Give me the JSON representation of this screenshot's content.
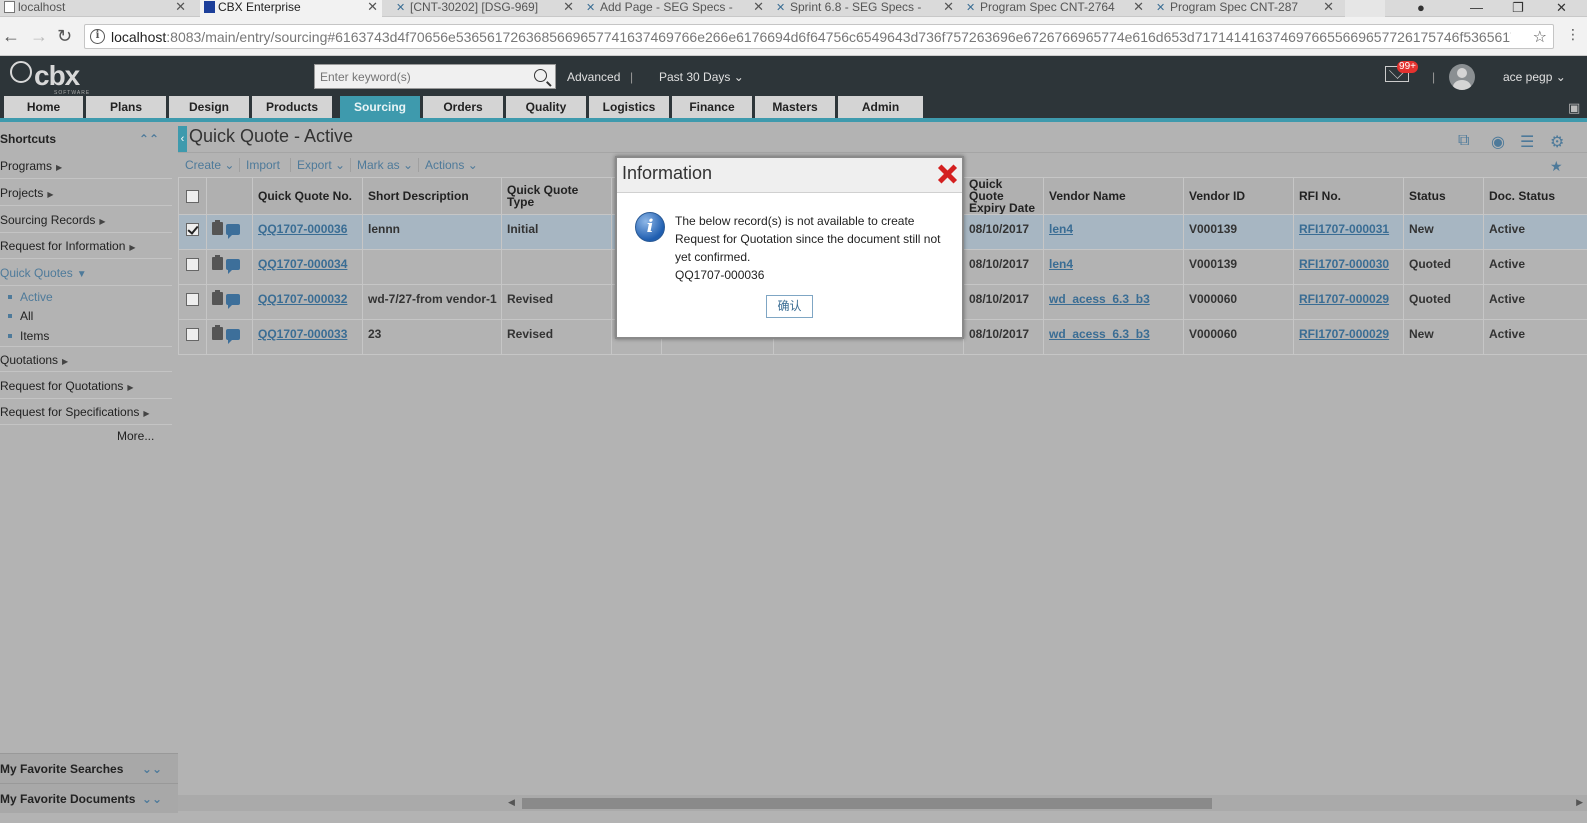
{
  "browser": {
    "tabs": [
      {
        "title": "localhost"
      },
      {
        "title": "CBX Enterprise"
      },
      {
        "title": "[CNT-30202] [DSG-969]"
      },
      {
        "title": "Add Page - SEG Specs -"
      },
      {
        "title": "Sprint 6.8 - SEG Specs -"
      },
      {
        "title": "Program Spec CNT-2764"
      },
      {
        "title": "Program Spec CNT-287"
      }
    ],
    "url_host": "localhost",
    "url_rest": ":8083/main/entry/sourcing#6163743d4f70656e5365617263685669657741637469766e266e6176694d6f64756c6549643d736f757263696e6726766965774e616d653d7171414163746976655669657726175746f53656172636..."
  },
  "app": {
    "logo_text": "cbx",
    "logo_sub": "SOFTWARE",
    "search_placeholder": "Enter keyword(s)",
    "advanced_label": "Advanced",
    "sep": "|",
    "period_label": "Past 30 Days",
    "mail_badge": "99+",
    "user_name": "ace pegp",
    "menu": [
      "Home",
      "Plans",
      "Design",
      "Products",
      "Sourcing",
      "Orders",
      "Quality",
      "Logistics",
      "Finance",
      "Masters",
      "Admin"
    ],
    "active_menu": "Sourcing"
  },
  "sidebar": {
    "shortcuts_label": "Shortcuts",
    "items": [
      "Programs",
      "Projects",
      "Sourcing Records",
      "Request for Information",
      "Quick Quotes",
      "Quotations",
      "Request for Quotations",
      "Request for Specifications"
    ],
    "quick_quote_subitems": [
      "Active",
      "All",
      "Items"
    ],
    "more_label": "More...",
    "fav_searches": "My Favorite Searches",
    "fav_documents": "My Favorite Documents"
  },
  "main": {
    "title": "Quick Quote - Active",
    "toolbar": [
      "Create",
      "Import",
      "Export",
      "Mark as",
      "Actions"
    ],
    "columns": {
      "quick_quote_no": "Quick Quote No.",
      "short_description": "Short Description",
      "quick_quote_type": "Quick Quote Type",
      "quick_quote_expiry": "Quick Quote Expiry Date",
      "vendor_name": "Vendor Name",
      "vendor_id": "Vendor ID",
      "rfi_no": "RFI No.",
      "status": "Status",
      "doc_status": "Doc. Status"
    },
    "rows": [
      {
        "selected": true,
        "no": "QQ1707-000036",
        "desc": "lennn",
        "type": "Initial",
        "expiry": "08/10/2017",
        "vendor": "len4",
        "vendor_id": "V000139",
        "rfi": "RFI1707-000031",
        "status": "New",
        "doc_status": "Active"
      },
      {
        "selected": false,
        "no": "QQ1707-000034",
        "desc": "",
        "type": "",
        "expiry": "08/10/2017",
        "vendor": "len4",
        "vendor_id": "V000139",
        "rfi": "RFI1707-000030",
        "status": "Quoted",
        "doc_status": "Active"
      },
      {
        "selected": false,
        "no": "QQ1707-000032",
        "desc": "wd-7/27-from vendor-1",
        "type": "Revised",
        "expiry": "08/10/2017",
        "vendor": "wd_acess_6.3_b3",
        "vendor_id": "V000060",
        "rfi": "RFI1707-000029",
        "status": "Quoted",
        "doc_status": "Active"
      },
      {
        "selected": false,
        "no": "QQ1707-000033",
        "desc": "23",
        "type": "Revised",
        "expiry": "08/10/2017",
        "vendor": "wd_acess_6.3_b3",
        "vendor_id": "V000060",
        "rfi": "RFI1707-000029",
        "status": "New",
        "doc_status": "Active"
      }
    ]
  },
  "dialog": {
    "title": "Information",
    "message": "The below record(s) is not available to create Request for Quotation since the document still not yet confirmed.",
    "record": "QQ1707-000036",
    "ok_label": "确认"
  }
}
